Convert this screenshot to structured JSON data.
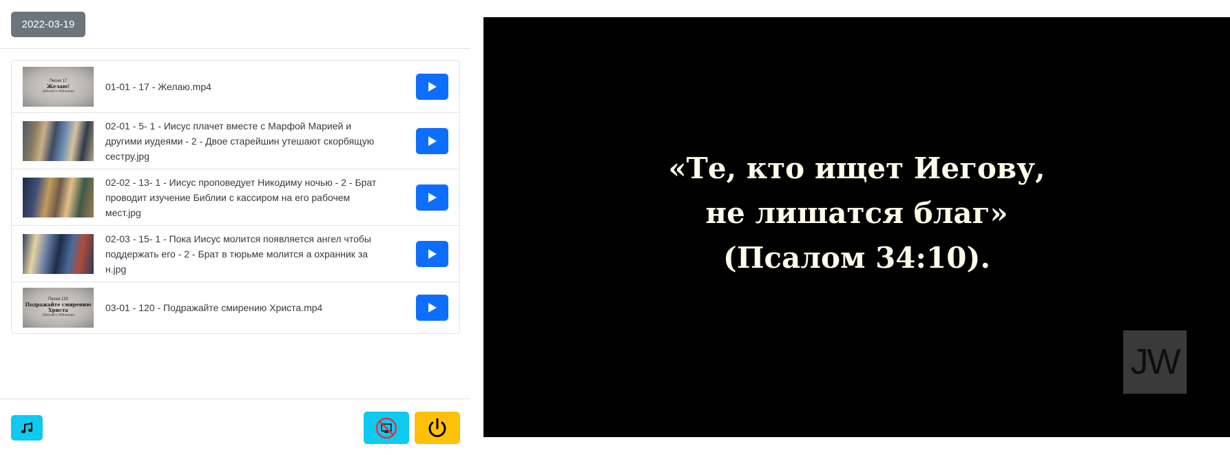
{
  "header": {
    "date": "2022-03-19"
  },
  "media_items": [
    {
      "label": "01-01 - 17 - Желаю.mp4",
      "thumb_type": "video-title-card",
      "thumb_lines": [
        "Песня 17",
        "Желаю!",
        "Jehovah's Witnesses"
      ]
    },
    {
      "label": "02-01 - 5- 1 - Иисус плачет вместе с Марфой Марией и другими иудеями - 2 - Двое старейшин утешают скорбящую сестру.jpg",
      "thumb_type": "photo"
    },
    {
      "label": "02-02 - 13- 1 - Иисус проповедует Никодиму ночью - 2 - Брат проводит изучение Библии с кассиром на его рабочем мест.jpg",
      "thumb_type": "photo"
    },
    {
      "label": "02-03 - 15- 1 - Пока Иисус молится появляется ангел чтобы поддержать его - 2 - Брат в тюрьме молится а охранник за н.jpg",
      "thumb_type": "photo"
    },
    {
      "label": "03-01 - 120 - Подражайте смирению Христа.mp4",
      "thumb_type": "video-title-card",
      "thumb_lines": [
        "Песня 120",
        "Подражайте смирению Христа",
        "Jehovah's Witnesses"
      ]
    }
  ],
  "buttons": {
    "play_icon": "play-icon",
    "music_icon": "music-note-icon",
    "screen_icon": "screen-off-icon",
    "power_icon": "power-icon"
  },
  "preview": {
    "lines": [
      "«Те, кто ищет Иегову,",
      "не лишатся благ»",
      "(Псалом 34:10)."
    ],
    "logo_text": "JW"
  },
  "colors": {
    "primary": "#0d6efd",
    "info": "#0dcaf0",
    "warning": "#ffc107",
    "secondary": "#6c757d",
    "preview_bg": "#000000",
    "scripture_text": "#fffbe8"
  }
}
